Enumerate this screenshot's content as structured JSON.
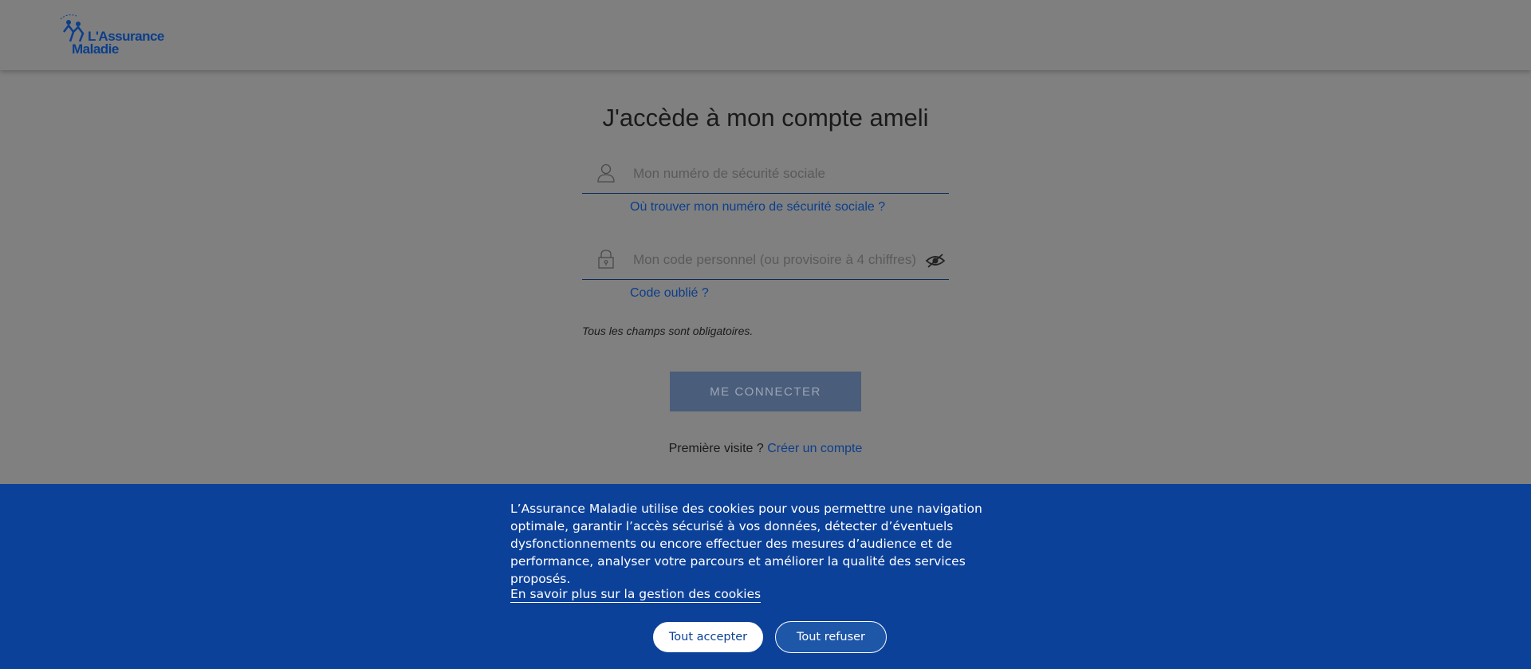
{
  "header": {
    "logo_line1": "L'Assurance",
    "logo_line2": "Maladie"
  },
  "login": {
    "title": "J'accède à mon compte ameli",
    "ssn_placeholder": "Mon numéro de sécurité sociale",
    "ssn_help_link": "Où trouver mon numéro de sécurité sociale ?",
    "code_placeholder": "Mon code personnel (ou provisoire à 4 chiffres)",
    "code_forgot_link": "Code oublié ?",
    "required_note": "Tous les champs sont obligatoires.",
    "connect_button": "ME CONNECTER",
    "first_visit_text": "Première visite ?",
    "create_account_link": "Créer un compte"
  },
  "cookies": {
    "message": "L’Assurance Maladie utilise des cookies pour vous permettre une navigation optimale, garantir l’accès sécurisé à vos données, détecter d’éventuels dysfonctionnements ou encore effectuer des mesures d’audience et de performance, analyser votre parcours et améliorer la qualité des services proposés.",
    "learn_more_link": "En savoir plus sur la gestion des cookies",
    "accept_button": "Tout accepter",
    "refuse_button": "Tout refuser"
  },
  "colors": {
    "brand_blue": "#0c3e8a",
    "banner_blue": "#0c419a",
    "overlay_gray": "#808080"
  },
  "icons": {
    "user": "user-icon",
    "lock": "lock-icon",
    "eye_off": "eye-off-icon"
  }
}
